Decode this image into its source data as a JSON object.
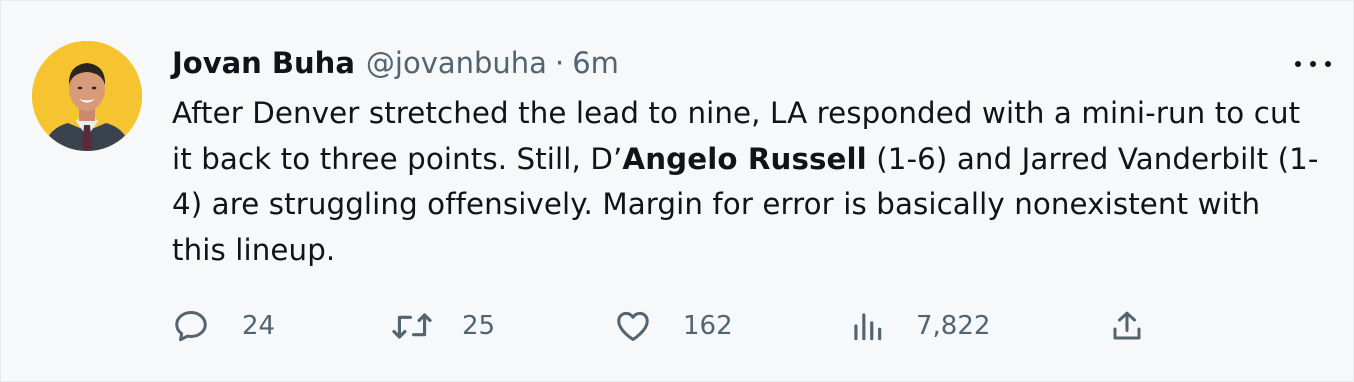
{
  "tweet": {
    "author_name": "Jovan Buha",
    "author_handle": "@jovanbuha",
    "separator": "·",
    "time": "6m",
    "text_part1": "After Denver stretched the lead to nine, LA responded with a mini-run to cut it back to three points. Still, D’",
    "text_bold": "Angelo Russell",
    "text_part2": " (1-6) and Jarred Vanderbilt (1-4) are struggling offensively. Margin for error is basically nonexistent with this lineup."
  },
  "actions": {
    "replies": "24",
    "retweets": "25",
    "likes": "162",
    "views": "7,822"
  },
  "icons": {
    "reply": "reply-icon",
    "retweet": "retweet-icon",
    "like": "heart-icon",
    "views": "views-icon",
    "share": "share-icon",
    "more": "more-icon"
  },
  "colors": {
    "background": "#f6f8f9",
    "text": "#0f1419",
    "secondary": "#536471",
    "avatar_bg": "#f6c431"
  }
}
